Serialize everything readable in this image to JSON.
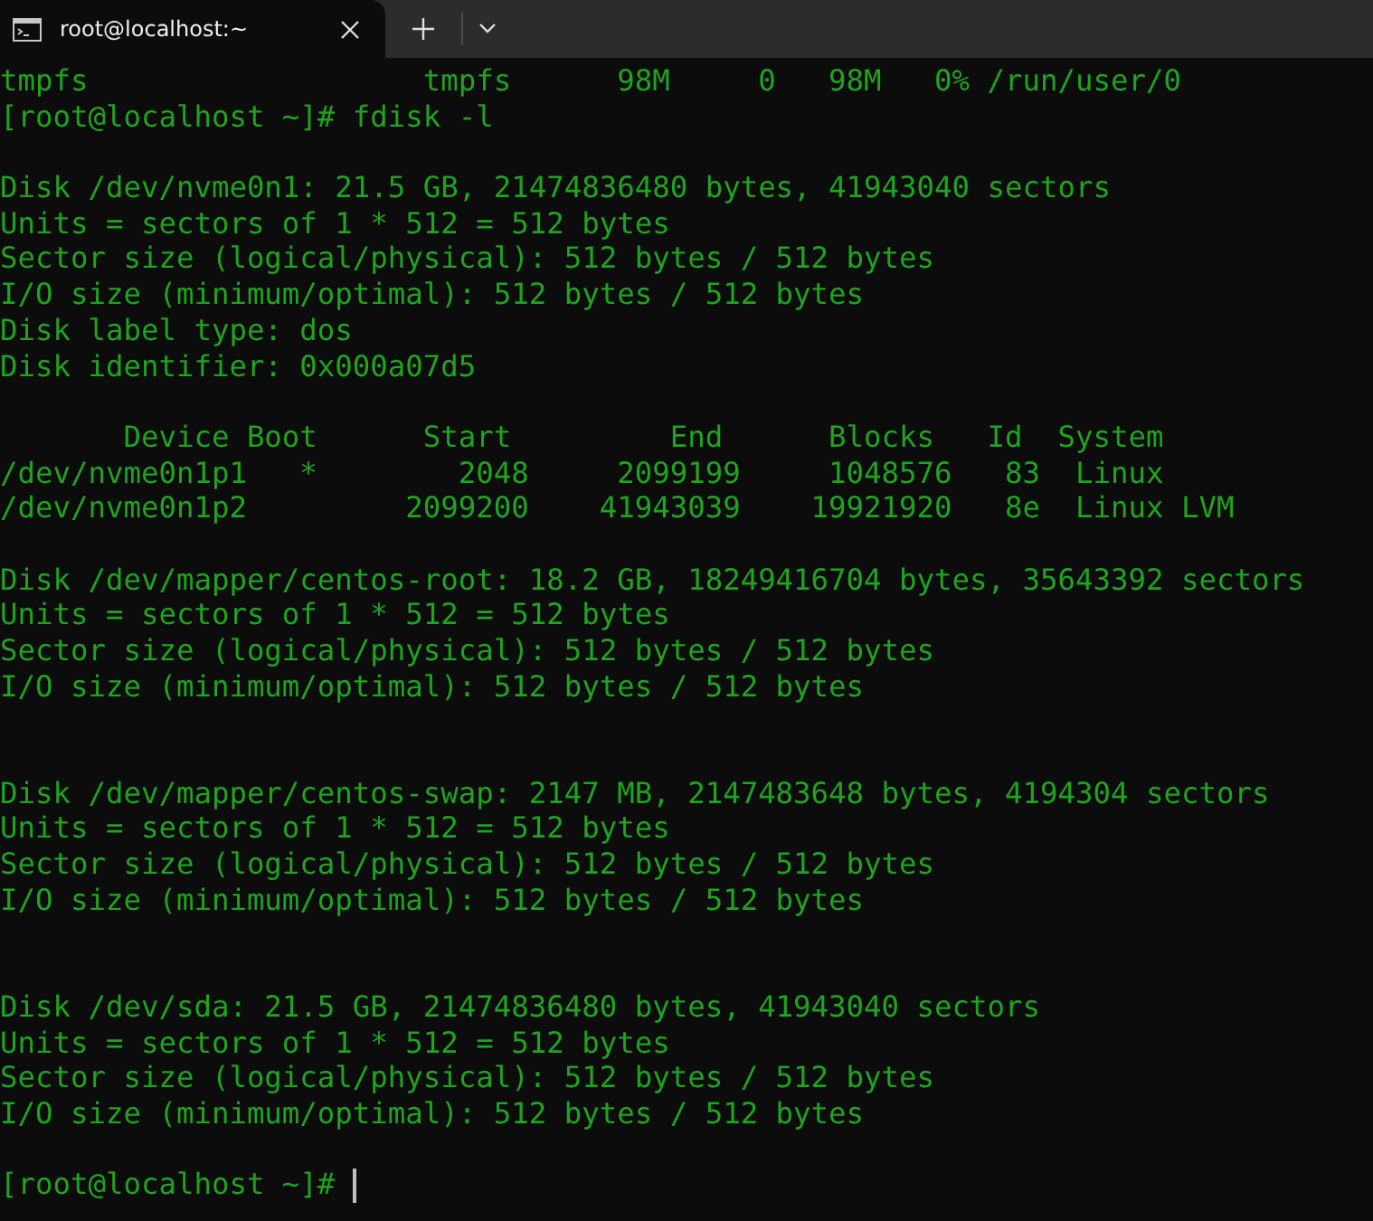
{
  "window": {
    "tab": {
      "title": "root@localhost:~",
      "selected": true
    }
  },
  "terminal": {
    "lines": [
      {
        "kind": "line",
        "text": "tmpfs                   tmpfs      98M     0   98M   0% /run/user/0"
      },
      {
        "kind": "line",
        "text": "[root@localhost ~]# fdisk -l"
      },
      {
        "kind": "blank"
      },
      {
        "kind": "line",
        "text": "Disk /dev/nvme0n1: 21.5 GB, 21474836480 bytes, 41943040 sectors"
      },
      {
        "kind": "line",
        "text": "Units = sectors of 1 * 512 = 512 bytes"
      },
      {
        "kind": "line",
        "text": "Sector size (logical/physical): 512 bytes / 512 bytes"
      },
      {
        "kind": "line",
        "text": "I/O size (minimum/optimal): 512 bytes / 512 bytes"
      },
      {
        "kind": "line",
        "text": "Disk label type: dos"
      },
      {
        "kind": "line",
        "text": "Disk identifier: 0x000a07d5"
      },
      {
        "kind": "blank"
      },
      {
        "kind": "line",
        "text": "       Device Boot      Start         End      Blocks   Id  System"
      },
      {
        "kind": "line",
        "text": "/dev/nvme0n1p1   *        2048     2099199     1048576   83  Linux"
      },
      {
        "kind": "line",
        "text": "/dev/nvme0n1p2         2099200    41943039    19921920   8e  Linux LVM"
      },
      {
        "kind": "blank"
      },
      {
        "kind": "line",
        "text": "Disk /dev/mapper/centos-root: 18.2 GB, 18249416704 bytes, 35643392 sectors"
      },
      {
        "kind": "line",
        "text": "Units = sectors of 1 * 512 = 512 bytes"
      },
      {
        "kind": "line",
        "text": "Sector size (logical/physical): 512 bytes / 512 bytes"
      },
      {
        "kind": "line",
        "text": "I/O size (minimum/optimal): 512 bytes / 512 bytes"
      },
      {
        "kind": "blank"
      },
      {
        "kind": "blank"
      },
      {
        "kind": "line",
        "text": "Disk /dev/mapper/centos-swap: 2147 MB, 2147483648 bytes, 4194304 sectors"
      },
      {
        "kind": "line",
        "text": "Units = sectors of 1 * 512 = 512 bytes"
      },
      {
        "kind": "line",
        "text": "Sector size (logical/physical): 512 bytes / 512 bytes"
      },
      {
        "kind": "line",
        "text": "I/O size (minimum/optimal): 512 bytes / 512 bytes"
      },
      {
        "kind": "blank"
      },
      {
        "kind": "blank"
      },
      {
        "kind": "line",
        "text": "Disk /dev/sda: 21.5 GB, 21474836480 bytes, 41943040 sectors"
      },
      {
        "kind": "line",
        "text": "Units = sectors of 1 * 512 = 512 bytes"
      },
      {
        "kind": "line",
        "text": "Sector size (logical/physical): 512 bytes / 512 bytes"
      },
      {
        "kind": "line",
        "text": "I/O size (minimum/optimal): 512 bytes / 512 bytes"
      },
      {
        "kind": "blank"
      },
      {
        "kind": "prompt",
        "text": "[root@localhost ~]#"
      }
    ]
  }
}
